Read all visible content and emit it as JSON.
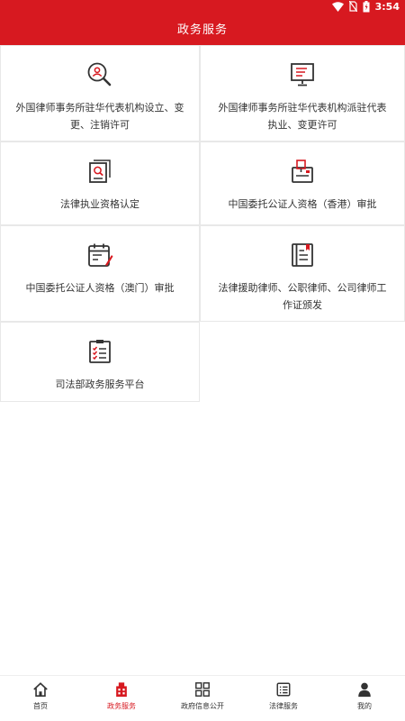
{
  "status_bar": {
    "time": "3:54",
    "icons": [
      "wifi-icon",
      "no-sim-icon",
      "battery-icon"
    ]
  },
  "header": {
    "title": "政务服务"
  },
  "services": [
    {
      "label": "外国律师事务所驻华代表机构设立、变更、注销许可",
      "icon": "person-search-icon"
    },
    {
      "label": "外国律师事务所驻华代表机构派驻代表执业、变更许可",
      "icon": "monitor-document-icon"
    },
    {
      "label": "法律执业资格认定",
      "icon": "document-search-icon"
    },
    {
      "label": "中国委托公证人资格（香港）审批",
      "icon": "folder-stamp-icon"
    },
    {
      "label": "中国委托公证人资格（澳门）审批",
      "icon": "calendar-pen-icon"
    },
    {
      "label": "法律援助律师、公职律师、公司律师工作证颁发",
      "icon": "book-bookmark-icon"
    },
    {
      "label": "司法部政务服务平台",
      "icon": "clipboard-checklist-icon"
    }
  ],
  "tabbar": {
    "tabs": [
      {
        "label": "首页",
        "icon": "home-icon",
        "active": false
      },
      {
        "label": "政务服务",
        "icon": "building-icon",
        "active": true
      },
      {
        "label": "政府信息公开",
        "icon": "grid-icon",
        "active": false
      },
      {
        "label": "法律服务",
        "icon": "list-icon",
        "active": false
      },
      {
        "label": "我的",
        "icon": "person-icon",
        "active": false
      }
    ]
  },
  "colors": {
    "accent": "#d71920",
    "icon_dark": "#333333",
    "divider": "#e8e8e8"
  }
}
